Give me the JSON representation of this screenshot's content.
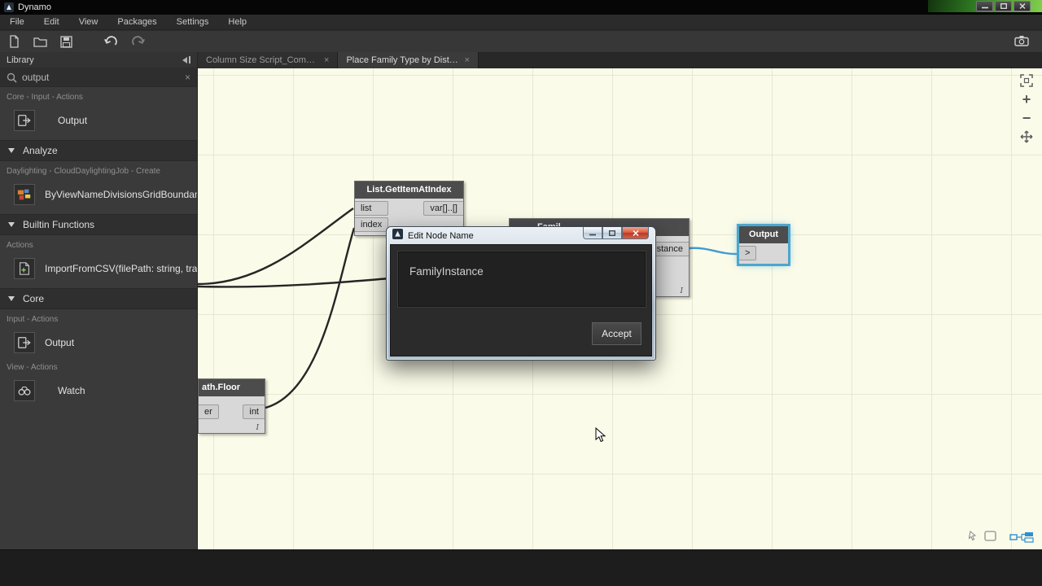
{
  "titlebar": {
    "title": "Dynamo"
  },
  "menubar": {
    "items": [
      "File",
      "Edit",
      "View",
      "Packages",
      "Settings",
      "Help"
    ]
  },
  "toolbar": {
    "icons": [
      "new-file",
      "open-folder",
      "save",
      "undo",
      "redo"
    ],
    "right_icons": [
      "camera"
    ]
  },
  "library": {
    "header": "Library",
    "search": {
      "value": "output",
      "clear_glyph": "×"
    },
    "entries": [
      {
        "kind": "category",
        "text": "Core - Input - Actions"
      },
      {
        "kind": "node",
        "text": "Output",
        "icon": "output-node-icon"
      },
      {
        "kind": "section",
        "text": "Analyze"
      },
      {
        "kind": "category",
        "text": "Daylighting - CloudDaylightingJob - Create"
      },
      {
        "kind": "node",
        "text": "ByViewNameDivisionsGridBoundan",
        "icon": "grid-boundary-icon"
      },
      {
        "kind": "section",
        "text": "Builtin Functions"
      },
      {
        "kind": "category",
        "text": "Actions"
      },
      {
        "kind": "node",
        "text": "ImportFromCSV(filePath: string, tran",
        "icon": "import-csv-icon"
      },
      {
        "kind": "section",
        "text": "Core"
      },
      {
        "kind": "category",
        "text": "Input - Actions"
      },
      {
        "kind": "node",
        "text": "Output",
        "icon": "output-node-icon"
      },
      {
        "kind": "category",
        "text": "View - Actions"
      },
      {
        "kind": "node",
        "text": "Watch",
        "icon": "watch-icon"
      }
    ]
  },
  "tabs": [
    {
      "label": "Column Size Script_Computatio",
      "close_glyph": "×",
      "active": false
    },
    {
      "label": "Place Family Type by Distance",
      "close_glyph": "×",
      "active": true
    }
  ],
  "canvas": {
    "zoom_controls": {
      "plus": "+",
      "minus": "−"
    },
    "nodes": {
      "list_get_item": {
        "title": "List.GetItemAtIndex",
        "inputs": [
          "list",
          "index"
        ],
        "output": "var[]..[]"
      },
      "family": {
        "title_visible": "Famil",
        "output_visible": "stance",
        "lacing": "I"
      },
      "output": {
        "title": "Output",
        "input": ">"
      },
      "floor": {
        "title_visible": "ath.Floor",
        "input_visible": "er",
        "output": "int",
        "lacing": "I"
      }
    }
  },
  "dialog": {
    "title": "Edit Node Name",
    "field_value": "FamilyInstance",
    "accept_label": "Accept"
  },
  "colors": {
    "canvas_bg": "#fbfbe9",
    "grid_line": "#e7e7d3",
    "selection_blue": "#4ba6cf",
    "wire_dark": "#262626",
    "wire_blue": "#3f9bd5",
    "accent_blue": "#2f8fd0"
  }
}
